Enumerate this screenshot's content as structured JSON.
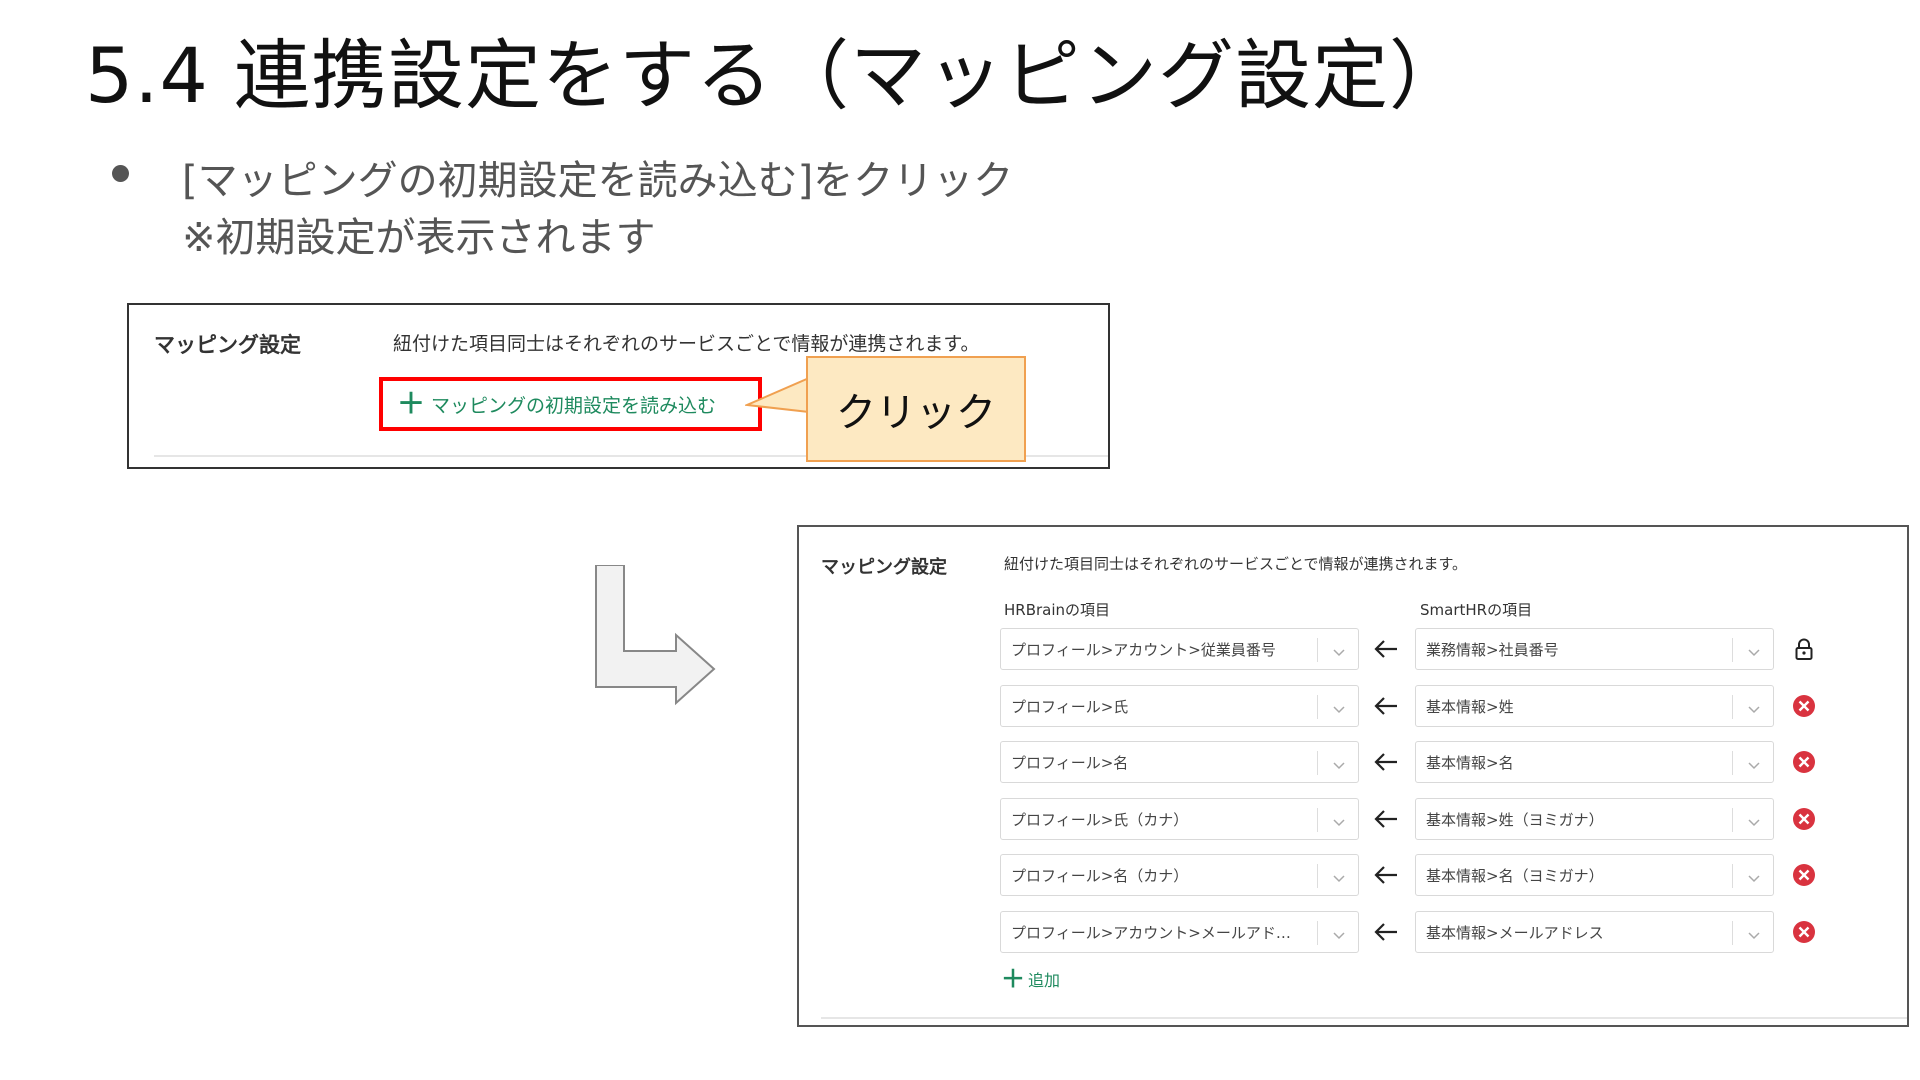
{
  "slide": {
    "title": "5.4 連携設定をする（マッピング設定）",
    "bullet_line1": "[マッピングの初期設定を読み込む]をクリック",
    "bullet_line2": "※初期設定が表示されます"
  },
  "before": {
    "section_label": "マッピング設定",
    "description": "紐付けた項目同士はそれぞれのサービスごとで情報が連携されます。",
    "load_button_plus": "＋",
    "load_button_label": "マッピングの初期設定を読み込む",
    "callout": "クリック"
  },
  "after": {
    "section_label": "マッピング設定",
    "description": "紐付けた項目同士はそれぞれのサービスごとで情報が連携されます。",
    "left_column_header": "HRBrainの項目",
    "right_column_header": "SmartHRの項目",
    "rows": [
      {
        "left": "プロフィール>アカウント>従業員番号",
        "right": "業務情報>社員番号",
        "icon": "lock-icon"
      },
      {
        "left": "プロフィール>氏",
        "right": "基本情報>姓",
        "icon": "remove-icon"
      },
      {
        "left": "プロフィール>名",
        "right": "基本情報>名",
        "icon": "remove-icon"
      },
      {
        "left": "プロフィール>氏（カナ）",
        "right": "基本情報>姓（ヨミガナ）",
        "icon": "remove-icon"
      },
      {
        "left": "プロフィール>名（カナ）",
        "right": "基本情報>名（ヨミガナ）",
        "icon": "remove-icon"
      },
      {
        "left": "プロフィール>アカウント>メールアド…",
        "right": "基本情報>メールアドレス",
        "icon": "remove-icon"
      }
    ],
    "add_plus": "＋",
    "add_label": "追加"
  },
  "colors": {
    "accent_green": "#1e8a5e",
    "highlight_red": "#ff0000",
    "callout_fill": "#fde9c2",
    "callout_border": "#f0a050",
    "remove_red": "#d9333f"
  }
}
